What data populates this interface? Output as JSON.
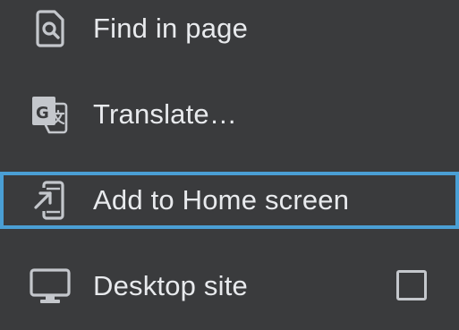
{
  "menu": {
    "items": [
      {
        "label": "Find in page",
        "icon": "find-in-page-icon"
      },
      {
        "label": "Translate…",
        "icon": "translate-icon"
      },
      {
        "label": "Add to Home screen",
        "icon": "add-to-home-screen-icon",
        "focused": true
      },
      {
        "label": "Desktop site",
        "icon": "desktop-icon",
        "checkbox": {
          "checked": false
        }
      }
    ]
  },
  "colors": {
    "background": "#3a3b3d",
    "text": "#e8eaed",
    "icon": "#c4c7cc",
    "focus_outline": "#4a9fd5"
  }
}
